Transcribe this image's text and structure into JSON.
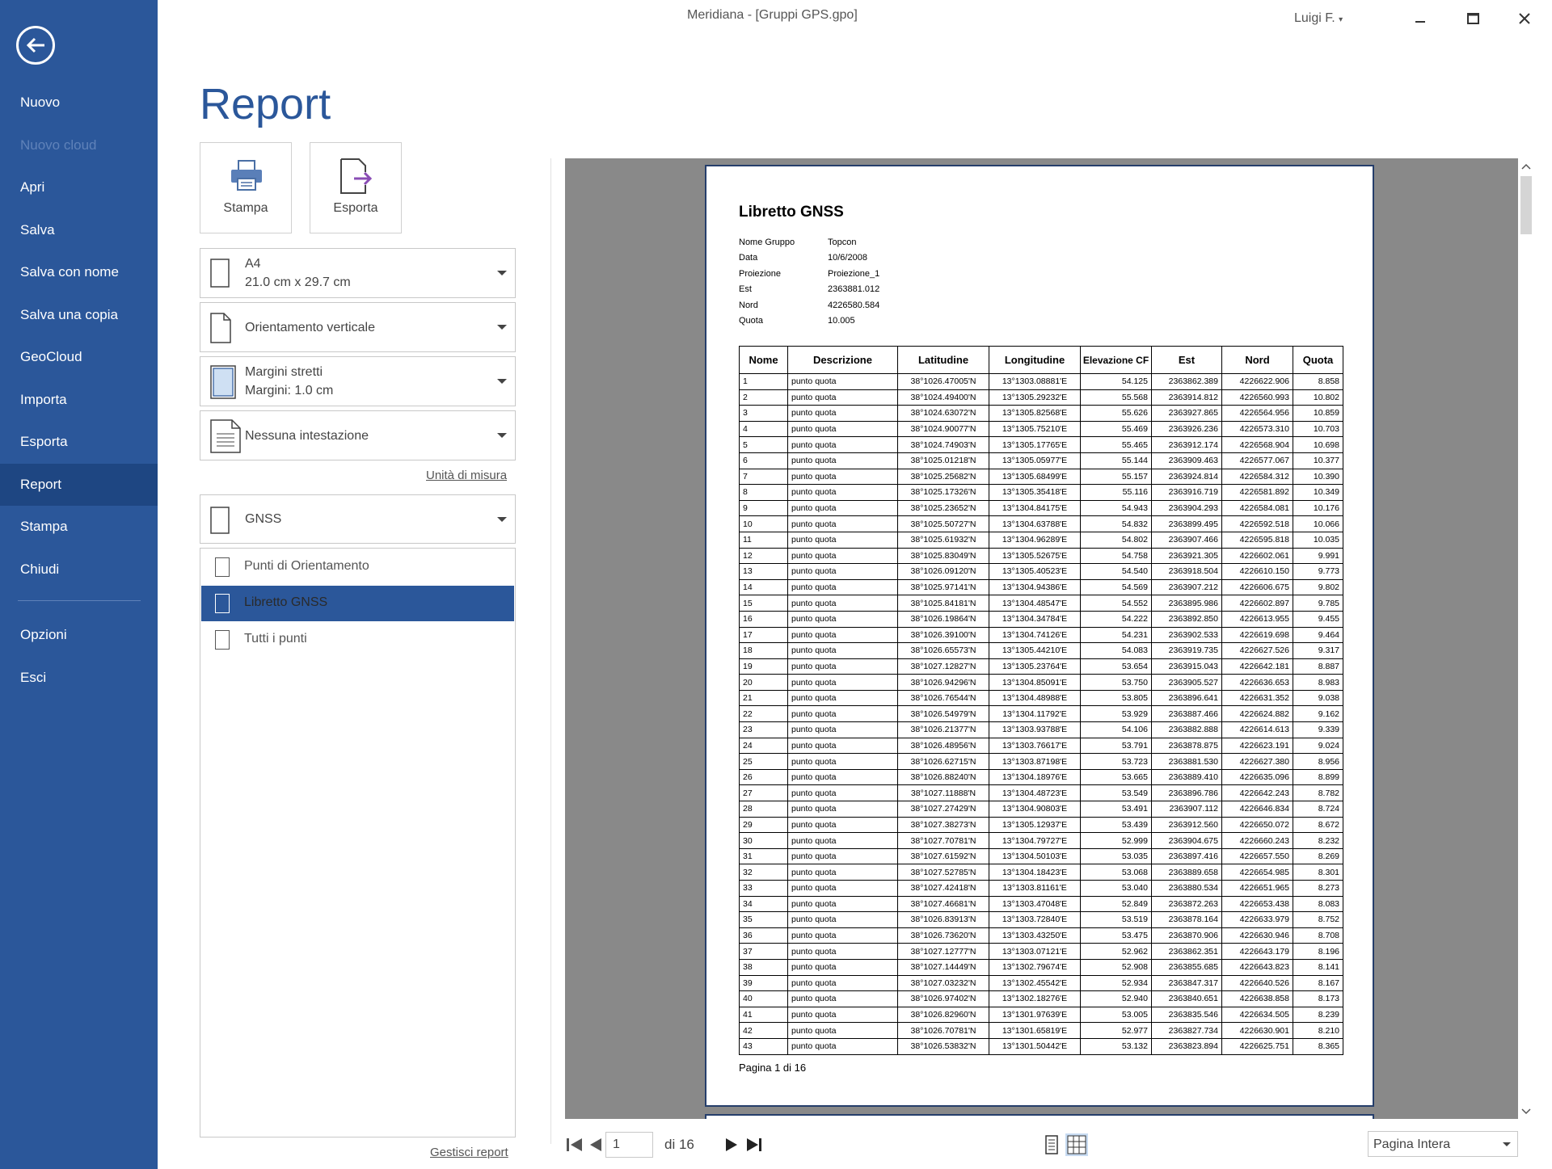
{
  "window": {
    "title": "Meridiana - [Gruppi GPS.gpo]",
    "user": "Luigi F."
  },
  "sidebar": {
    "items": [
      "Nuovo",
      "Nuovo cloud",
      "Apri",
      "Salva",
      "Salva con nome",
      "Salva una copia",
      "GeoCloud",
      "Importa",
      "Esporta",
      "Report",
      "Stampa",
      "Chiudi"
    ],
    "items2": [
      "Opzioni",
      "Esci"
    ],
    "active": "Report",
    "disabled": "Nuovo cloud"
  },
  "page": {
    "title": "Report"
  },
  "actions": {
    "print": "Stampa",
    "export": "Esporta"
  },
  "settings": {
    "paper": {
      "name": "A4",
      "size": "21.0 cm x 29.7 cm"
    },
    "orientation": "Orientamento verticale",
    "margins": {
      "name": "Margini stretti",
      "value": "Margini:  1.0 cm"
    },
    "header": "Nessuna intestazione",
    "units_link": "Unità di misura",
    "category": "GNSS",
    "reports": [
      "Punti di Orientamento",
      "Libretto GNSS",
      "Tutti i punti"
    ],
    "selected_report": "Libretto GNSS",
    "manage_link": "Gestisci report"
  },
  "document": {
    "title": "Libretto GNSS",
    "meta": [
      {
        "k": "Nome Gruppo",
        "v": "Topcon"
      },
      {
        "k": "Data",
        "v": "10/6/2008"
      },
      {
        "k": "Proiezione",
        "v": "Proiezione_1"
      },
      {
        "k": "Est",
        "v": "2363881.012"
      },
      {
        "k": "Nord",
        "v": "4226580.584"
      },
      {
        "k": "Quota",
        "v": "10.005"
      }
    ],
    "columns": [
      "Nome",
      "Descrizione",
      "Latitudine",
      "Longitudine",
      "Elevazione CF",
      "Est",
      "Nord",
      "Quota"
    ],
    "rows": [
      [
        "1",
        "punto quota",
        "38°1026.47005'N",
        "13°1303.08881'E",
        "54.125",
        "2363862.389",
        "4226622.906",
        "8.858"
      ],
      [
        "2",
        "punto quota",
        "38°1024.49400'N",
        "13°1305.29232'E",
        "55.568",
        "2363914.812",
        "4226560.993",
        "10.802"
      ],
      [
        "3",
        "punto quota",
        "38°1024.63072'N",
        "13°1305.82568'E",
        "55.626",
        "2363927.865",
        "4226564.956",
        "10.859"
      ],
      [
        "4",
        "punto quota",
        "38°1024.90077'N",
        "13°1305.75210'E",
        "55.469",
        "2363926.236",
        "4226573.310",
        "10.703"
      ],
      [
        "5",
        "punto quota",
        "38°1024.74903'N",
        "13°1305.17765'E",
        "55.465",
        "2363912.174",
        "4226568.904",
        "10.698"
      ],
      [
        "6",
        "punto quota",
        "38°1025.01218'N",
        "13°1305.05977'E",
        "55.144",
        "2363909.463",
        "4226577.067",
        "10.377"
      ],
      [
        "7",
        "punto quota",
        "38°1025.25682'N",
        "13°1305.68499'E",
        "55.157",
        "2363924.814",
        "4226584.312",
        "10.390"
      ],
      [
        "8",
        "punto quota",
        "38°1025.17326'N",
        "13°1305.35418'E",
        "55.116",
        "2363916.719",
        "4226581.892",
        "10.349"
      ],
      [
        "9",
        "punto quota",
        "38°1025.23652'N",
        "13°1304.84175'E",
        "54.943",
        "2363904.293",
        "4226584.081",
        "10.176"
      ],
      [
        "10",
        "punto quota",
        "38°1025.50727'N",
        "13°1304.63788'E",
        "54.832",
        "2363899.495",
        "4226592.518",
        "10.066"
      ],
      [
        "11",
        "punto quota",
        "38°1025.61932'N",
        "13°1304.96289'E",
        "54.802",
        "2363907.466",
        "4226595.818",
        "10.035"
      ],
      [
        "12",
        "punto quota",
        "38°1025.83049'N",
        "13°1305.52675'E",
        "54.758",
        "2363921.305",
        "4226602.061",
        "9.991"
      ],
      [
        "13",
        "punto quota",
        "38°1026.09120'N",
        "13°1305.40523'E",
        "54.540",
        "2363918.504",
        "4226610.150",
        "9.773"
      ],
      [
        "14",
        "punto quota",
        "38°1025.97141'N",
        "13°1304.94386'E",
        "54.569",
        "2363907.212",
        "4226606.675",
        "9.802"
      ],
      [
        "15",
        "punto quota",
        "38°1025.84181'N",
        "13°1304.48547'E",
        "54.552",
        "2363895.986",
        "4226602.897",
        "9.785"
      ],
      [
        "16",
        "punto quota",
        "38°1026.19864'N",
        "13°1304.34784'E",
        "54.222",
        "2363892.850",
        "4226613.955",
        "9.455"
      ],
      [
        "17",
        "punto quota",
        "38°1026.39100'N",
        "13°1304.74126'E",
        "54.231",
        "2363902.533",
        "4226619.698",
        "9.464"
      ],
      [
        "18",
        "punto quota",
        "38°1026.65573'N",
        "13°1305.44210'E",
        "54.083",
        "2363919.735",
        "4226627.526",
        "9.317"
      ],
      [
        "19",
        "punto quota",
        "38°1027.12827'N",
        "13°1305.23764'E",
        "53.654",
        "2363915.043",
        "4226642.181",
        "8.887"
      ],
      [
        "20",
        "punto quota",
        "38°1026.94296'N",
        "13°1304.85091'E",
        "53.750",
        "2363905.527",
        "4226636.653",
        "8.983"
      ],
      [
        "21",
        "punto quota",
        "38°1026.76544'N",
        "13°1304.48988'E",
        "53.805",
        "2363896.641",
        "4226631.352",
        "9.038"
      ],
      [
        "22",
        "punto quota",
        "38°1026.54979'N",
        "13°1304.11792'E",
        "53.929",
        "2363887.466",
        "4226624.882",
        "9.162"
      ],
      [
        "23",
        "punto quota",
        "38°1026.21377'N",
        "13°1303.93788'E",
        "54.106",
        "2363882.888",
        "4226614.613",
        "9.339"
      ],
      [
        "24",
        "punto quota",
        "38°1026.48956'N",
        "13°1303.76617'E",
        "53.791",
        "2363878.875",
        "4226623.191",
        "9.024"
      ],
      [
        "25",
        "punto quota",
        "38°1026.62715'N",
        "13°1303.87198'E",
        "53.723",
        "2363881.530",
        "4226627.380",
        "8.956"
      ],
      [
        "26",
        "punto quota",
        "38°1026.88240'N",
        "13°1304.18976'E",
        "53.665",
        "2363889.410",
        "4226635.096",
        "8.899"
      ],
      [
        "27",
        "punto quota",
        "38°1027.11888'N",
        "13°1304.48723'E",
        "53.549",
        "2363896.786",
        "4226642.243",
        "8.782"
      ],
      [
        "28",
        "punto quota",
        "38°1027.27429'N",
        "13°1304.90803'E",
        "53.491",
        "2363907.112",
        "4226646.834",
        "8.724"
      ],
      [
        "29",
        "punto quota",
        "38°1027.38273'N",
        "13°1305.12937'E",
        "53.439",
        "2363912.560",
        "4226650.072",
        "8.672"
      ],
      [
        "30",
        "punto quota",
        "38°1027.70781'N",
        "13°1304.79727'E",
        "52.999",
        "2363904.675",
        "4226660.243",
        "8.232"
      ],
      [
        "31",
        "punto quota",
        "38°1027.61592'N",
        "13°1304.50103'E",
        "53.035",
        "2363897.416",
        "4226657.550",
        "8.269"
      ],
      [
        "32",
        "punto quota",
        "38°1027.52785'N",
        "13°1304.18423'E",
        "53.068",
        "2363889.658",
        "4226654.985",
        "8.301"
      ],
      [
        "33",
        "punto quota",
        "38°1027.42418'N",
        "13°1303.81161'E",
        "53.040",
        "2363880.534",
        "4226651.965",
        "8.273"
      ],
      [
        "34",
        "punto quota",
        "38°1027.46681'N",
        "13°1303.47048'E",
        "52.849",
        "2363872.263",
        "4226653.438",
        "8.083"
      ],
      [
        "35",
        "punto quota",
        "38°1026.83913'N",
        "13°1303.72840'E",
        "53.519",
        "2363878.164",
        "4226633.979",
        "8.752"
      ],
      [
        "36",
        "punto quota",
        "38°1026.73620'N",
        "13°1303.43250'E",
        "53.475",
        "2363870.906",
        "4226630.946",
        "8.708"
      ],
      [
        "37",
        "punto quota",
        "38°1027.12777'N",
        "13°1303.07121'E",
        "52.962",
        "2363862.351",
        "4226643.179",
        "8.196"
      ],
      [
        "38",
        "punto quota",
        "38°1027.14449'N",
        "13°1302.79674'E",
        "52.908",
        "2363855.685",
        "4226643.823",
        "8.141"
      ],
      [
        "39",
        "punto quota",
        "38°1027.03232'N",
        "13°1302.45542'E",
        "52.934",
        "2363847.317",
        "4226640.526",
        "8.167"
      ],
      [
        "40",
        "punto quota",
        "38°1026.97402'N",
        "13°1302.18276'E",
        "52.940",
        "2363840.651",
        "4226638.858",
        "8.173"
      ],
      [
        "41",
        "punto quota",
        "38°1026.82960'N",
        "13°1301.97639'E",
        "53.005",
        "2363835.546",
        "4226634.505",
        "8.239"
      ],
      [
        "42",
        "punto quota",
        "38°1026.70781'N",
        "13°1301.65819'E",
        "52.977",
        "2363827.734",
        "4226630.901",
        "8.210"
      ],
      [
        "43",
        "punto quota",
        "38°1026.53832'N",
        "13°1301.50442'E",
        "53.132",
        "2363823.894",
        "4226625.751",
        "8.365"
      ]
    ],
    "footer": "Pagina 1 di 16"
  },
  "pager": {
    "current": "1",
    "total_label": "di 16",
    "zoom": "Pagina Intera"
  },
  "colors": {
    "sidebar": "#2b579a",
    "sidebar_active": "#1e4682",
    "accent": "#2b579a",
    "preview_bg": "#898989"
  }
}
